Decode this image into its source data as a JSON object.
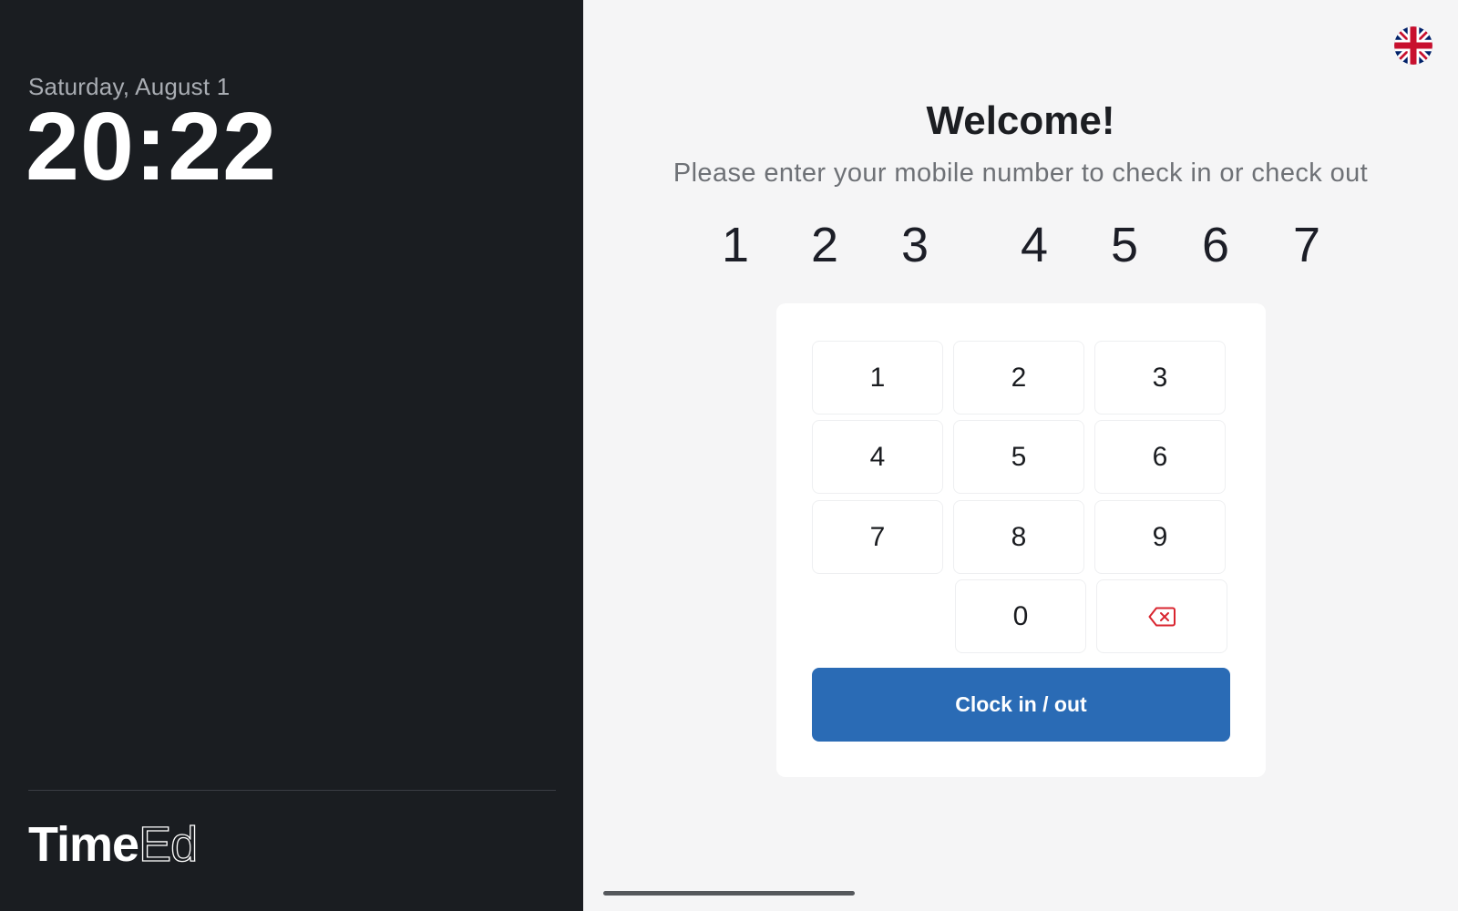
{
  "left_panel": {
    "date": "Saturday, August 1",
    "time": "20:22",
    "brand_bold": "Time",
    "brand_thin": "Ed"
  },
  "header": {
    "language_icon": "uk-flag-icon",
    "title": "Welcome!",
    "subtitle": "Please enter your mobile number to check in or check out"
  },
  "entered_digits": [
    "1",
    "2",
    "3",
    "4",
    "5",
    "6",
    "7"
  ],
  "keypad": {
    "keys": [
      "1",
      "2",
      "3",
      "4",
      "5",
      "6",
      "7",
      "8",
      "9",
      "0"
    ],
    "backspace_icon": "backspace-icon",
    "submit_label": "Clock in / out"
  },
  "colors": {
    "left_panel_bg": "#1a1d21",
    "right_panel_bg": "#f5f5f6",
    "primary_button": "#2a6bb5",
    "backspace_icon": "#d9252f"
  }
}
